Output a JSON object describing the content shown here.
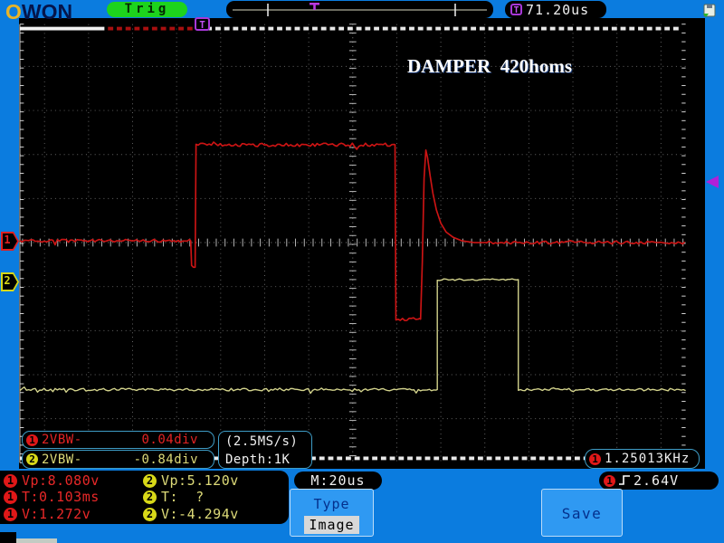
{
  "header": {
    "logo_o": "O",
    "logo_rest": "WON",
    "trig_status": "Trig",
    "trigger_icon": "T",
    "trigger_time": "71.20us"
  },
  "scope": {
    "annotation": "DAMPER  420homs",
    "top_marker": "T",
    "ch1_flag": "1",
    "ch2_flag": "2"
  },
  "readouts": {
    "ch1_badge": "1",
    "ch1_label": "2VBW-",
    "ch1_value": "0.04div",
    "ch2_badge": "2",
    "ch2_label": "2VBW-",
    "ch2_value": "-0.84div",
    "sample_rate": "(2.5MS/s)",
    "depth": "Depth:1K",
    "freq_badge": "1",
    "frequency": "1.25013KHz"
  },
  "measurements": {
    "ch1": {
      "badge": "1",
      "rows": [
        "Vp:8.080v",
        "T:0.103ms",
        "V:1.272v"
      ]
    },
    "ch2": {
      "badge": "2",
      "rows": [
        "Vp:5.120v",
        "T:  ?",
        "V:-4.294v"
      ]
    }
  },
  "bottom": {
    "timebase": "M:20us",
    "trigger_level_badge": "1",
    "trigger_level": "2.64V",
    "type_button_title": "Type",
    "type_button_value": "Image",
    "save_button": "Save"
  },
  "colors": {
    "background": "#0b7cdf",
    "ch1": "#cc1414",
    "ch2": "#d6d68e",
    "trig_green": "#1dd31d",
    "accent_purple": "#a838d8",
    "badge_red": "#e01818",
    "badge_yellow": "#d8d818"
  },
  "chart_data": {
    "type": "line",
    "title": "DAMPER 420homs",
    "xlabel": "time (M:20us per div, 50px/div)",
    "ylabel": "volts (2V per div, 50px/div)",
    "grid": "dotted 50px divisions, center cross at x=400,y=268",
    "series": [
      {
        "name": "CH1",
        "color": "#cc1414",
        "width": 1.7,
        "segments": [
          {
            "kind": "noisy",
            "x1": 22,
            "x2": 216,
            "y": 266,
            "amp": 1.6
          },
          {
            "kind": "path",
            "pts": [
              [
                216,
                266
              ],
              [
                217,
                294
              ],
              [
                219,
                296
              ],
              [
                221,
                296
              ],
              [
                222,
                161
              ]
            ]
          },
          {
            "kind": "noisy",
            "x1": 222,
            "x2": 448,
            "y": 157,
            "amp": 1.9
          },
          {
            "kind": "path",
            "pts": [
              [
                448,
                157
              ],
              [
                449,
                355
              ]
            ]
          },
          {
            "kind": "noisy",
            "x1": 449,
            "x2": 477,
            "y": 355,
            "amp": 1.6
          },
          {
            "kind": "path",
            "pts": [
              [
                477,
                355
              ],
              [
                479,
                290
              ],
              [
                481,
                195
              ],
              [
                483,
                163
              ]
            ]
          },
          {
            "kind": "path",
            "pts": [
              [
                483,
                163
              ],
              [
                485,
                172
              ],
              [
                488,
                193
              ],
              [
                491,
                212
              ],
              [
                495,
                231
              ],
              [
                500,
                246
              ],
              [
                506,
                256
              ],
              [
                514,
                262
              ],
              [
                524,
                266
              ],
              [
                538,
                268
              ],
              [
                552,
                268
              ]
            ]
          },
          {
            "kind": "noisy",
            "x1": 552,
            "x2": 778,
            "y": 268,
            "amp": 1.6
          }
        ]
      },
      {
        "name": "CH2",
        "color": "#d6d68e",
        "width": 1.4,
        "segments": [
          {
            "kind": "noisy",
            "x1": 22,
            "x2": 496,
            "y": 435,
            "amp": 1.4
          },
          {
            "kind": "path",
            "pts": [
              [
                496,
                435
              ],
              [
                496,
                311
              ]
            ]
          },
          {
            "kind": "noisy",
            "x1": 496,
            "x2": 588,
            "y": 310,
            "amp": 1.1
          },
          {
            "kind": "path",
            "pts": [
              [
                588,
                310
              ],
              [
                588,
                434
              ]
            ]
          },
          {
            "kind": "noisy",
            "x1": 588,
            "x2": 778,
            "y": 435,
            "amp": 1.4
          }
        ]
      }
    ]
  }
}
